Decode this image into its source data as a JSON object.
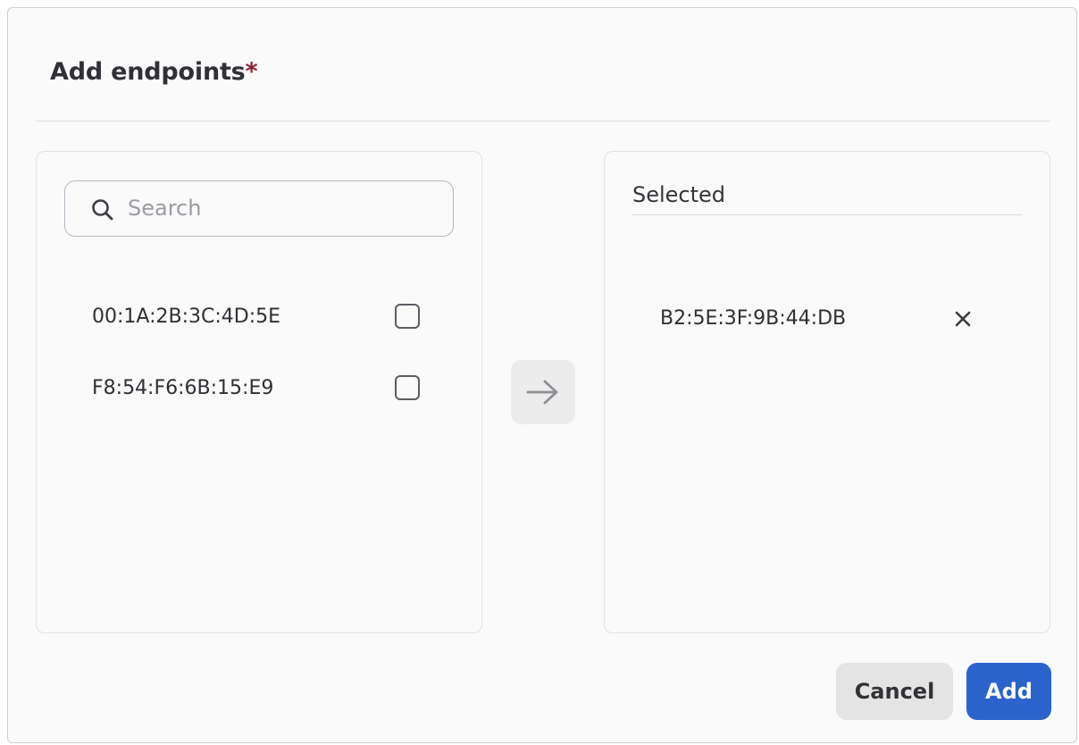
{
  "dialog": {
    "title": "Add endpoints",
    "required_marker": "*"
  },
  "available": {
    "search": {
      "placeholder": "Search",
      "value": ""
    },
    "items": [
      {
        "label": "00:1A:2B:3C:4D:5E",
        "checked": false
      },
      {
        "label": "F8:54:F6:6B:15:E9",
        "checked": false
      }
    ]
  },
  "transfer": {
    "icon": "arrow-right-icon"
  },
  "selected": {
    "heading": "Selected",
    "items": [
      {
        "label": "B2:5E:3F:9B:44:DB",
        "icon": "close-icon"
      }
    ]
  },
  "footer": {
    "cancel_label": "Cancel",
    "add_label": "Add"
  },
  "colors": {
    "accent": "#2c62cc",
    "required": "#8c2033"
  }
}
